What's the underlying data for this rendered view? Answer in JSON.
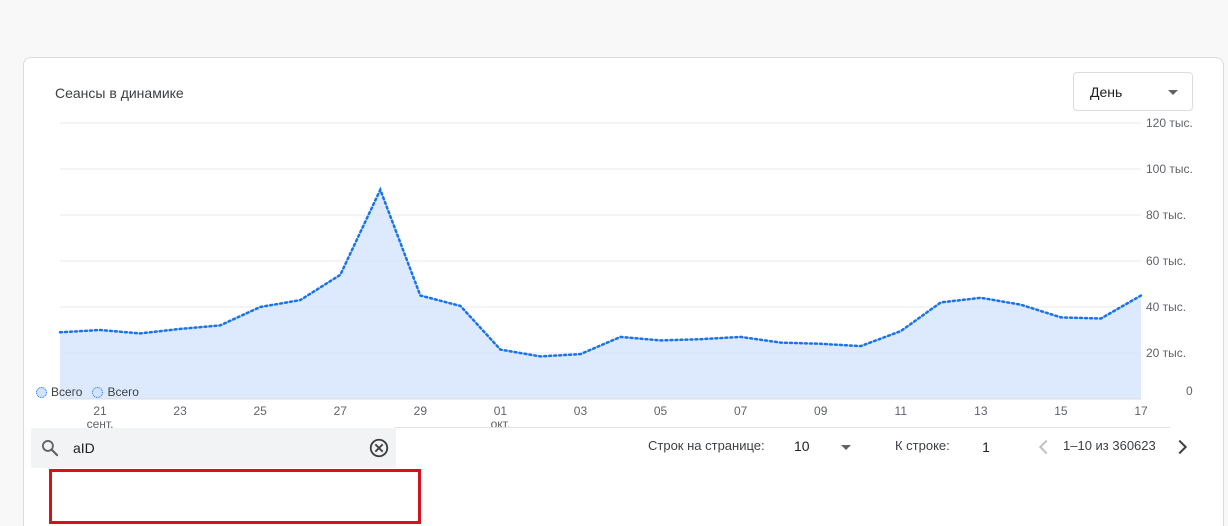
{
  "card": {
    "title": "Сеансы в динамике",
    "period_select": {
      "value": "День"
    }
  },
  "legend": [
    {
      "label": "Всего"
    },
    {
      "label": "Всего"
    }
  ],
  "search": {
    "value": "aID",
    "placeholder": ""
  },
  "pagination": {
    "rows_per_page_label": "Строк на странице:",
    "rows_per_page_value": "10",
    "goto_row_label": "К строке:",
    "goto_row_value": "1",
    "range_text": "1–10 из 360623"
  },
  "colors": {
    "line": "#1a73e8",
    "area": "#d2e3fc",
    "highlight": "#d6111e"
  },
  "icons": [
    "search-icon",
    "clear-circle-icon",
    "chevron-left-icon",
    "chevron-right-icon",
    "caret-down-icon"
  ],
  "chart_data": {
    "type": "area",
    "title": "",
    "y_tick_labels": [
      "0",
      "20 тыс.",
      "40 тыс.",
      "60 тыс.",
      "80 тыс.",
      "100 тыс.",
      "120 тыс."
    ],
    "y_tick_values": [
      0,
      20000,
      40000,
      60000,
      80000,
      100000,
      120000
    ],
    "ylim": [
      0,
      120000
    ],
    "x_tick_labels": [
      {
        "day": "20",
        "label": "21",
        "sub": "сент."
      },
      {
        "day": "22",
        "label": "23",
        "sub": ""
      },
      {
        "day": "24",
        "label": "25",
        "sub": ""
      },
      {
        "day": "26",
        "label": "27",
        "sub": ""
      },
      {
        "day": "28",
        "label": "29",
        "sub": ""
      },
      {
        "day": "30",
        "label": "01",
        "sub": "окт."
      },
      {
        "day": "32",
        "label": "03",
        "sub": ""
      },
      {
        "day": "34",
        "label": "05",
        "sub": ""
      },
      {
        "day": "36",
        "label": "07",
        "sub": ""
      },
      {
        "day": "38",
        "label": "09",
        "sub": ""
      },
      {
        "day": "40",
        "label": "11",
        "sub": ""
      },
      {
        "day": "42",
        "label": "13",
        "sub": ""
      },
      {
        "day": "44",
        "label": "15",
        "sub": ""
      },
      {
        "day": "46",
        "label": "17",
        "sub": ""
      }
    ],
    "series": [
      {
        "name": "Всего",
        "x": [
          "20 сент.",
          "21 сент.",
          "22 сент.",
          "23 сент.",
          "24 сент.",
          "25 сент.",
          "26 сент.",
          "27 сент.",
          "28 сент.",
          "29 сент.",
          "30 сент.",
          "01 окт.",
          "02 окт.",
          "03 окт.",
          "04 окт.",
          "05 окт.",
          "06 окт.",
          "07 окт.",
          "08 окт.",
          "09 окт.",
          "10 окт.",
          "11 окт.",
          "12 окт.",
          "13 окт.",
          "14 окт.",
          "15 окт.",
          "16 окт.",
          "17 окт."
        ],
        "values": [
          29000,
          30000,
          28500,
          30500,
          32000,
          40000,
          43000,
          54000,
          91000,
          45000,
          40500,
          21500,
          18500,
          19500,
          27000,
          25500,
          26000,
          27000,
          24500,
          24000,
          23000,
          29500,
          42000,
          44000,
          41000,
          35500,
          35000,
          45000
        ]
      }
    ],
    "grid": true,
    "legend_position": "bottom-left"
  }
}
